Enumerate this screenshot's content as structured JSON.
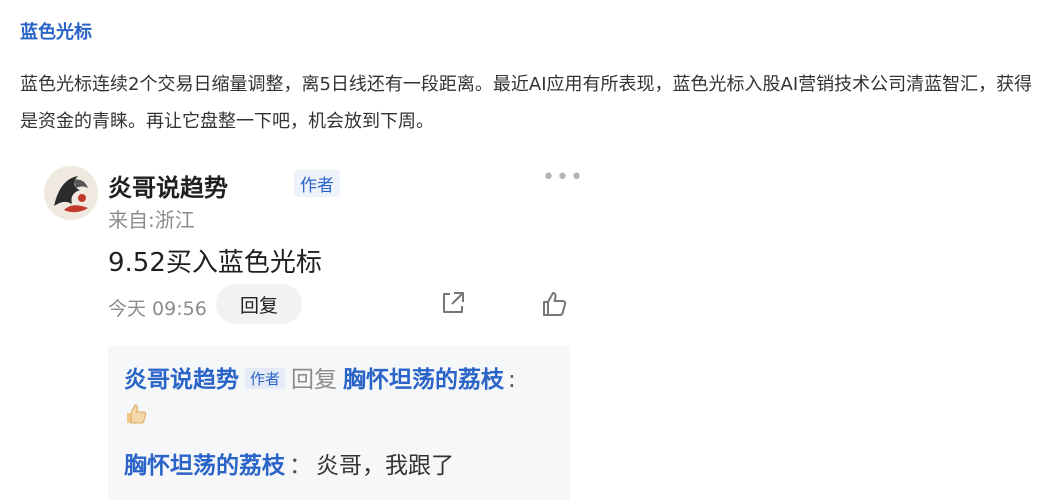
{
  "stock": {
    "name": "蓝色光标"
  },
  "post": {
    "text": "蓝色光标连续2个交易日缩量调整，离5日线还有一段距离。最近AI应用有所表现，蓝色光标入股AI营销技术公司清蓝智汇，获得是资金的青睐。再让它盘整一下吧，机会放到下周。"
  },
  "comment": {
    "author": "炎哥说趋势",
    "author_badge": "作者",
    "location": "来自:浙江",
    "text": "9.52买入蓝色光标",
    "time": "今天 09:56",
    "reply_label": "回复",
    "more_icon": "more-dots-icon",
    "share_icon": "share-icon",
    "like_icon": "thumbs-up-icon"
  },
  "replies": [
    {
      "user": "炎哥说趋势",
      "badge": "作者",
      "verb": "回复",
      "target": "胸怀坦荡的荔枝",
      "separator": ":",
      "content_icon": "thumbs-up-emoji"
    },
    {
      "user": "胸怀坦荡的荔枝",
      "separator": "：",
      "text": "炎哥，我跟了"
    }
  ],
  "colors": {
    "link_blue": "#2a64c8",
    "muted_gray": "#8d8d8d",
    "reply_bg": "#f6f7f9"
  }
}
